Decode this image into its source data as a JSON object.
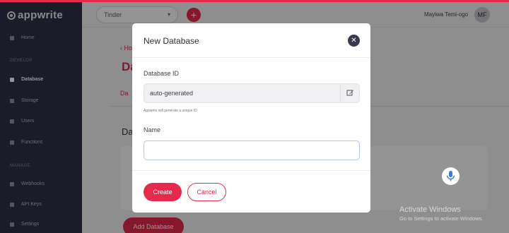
{
  "app": {
    "logo_text": "appwrite"
  },
  "sidebar": {
    "items": [
      {
        "label": "Home",
        "icon": "home-icon"
      },
      {
        "label": "Database",
        "icon": "database-icon",
        "active": true
      },
      {
        "label": "Storage",
        "icon": "storage-icon"
      },
      {
        "label": "Users",
        "icon": "users-icon"
      },
      {
        "label": "Functions",
        "icon": "functions-icon"
      },
      {
        "label": "Webhooks",
        "icon": "webhooks-icon"
      },
      {
        "label": "API Keys",
        "icon": "api-keys-icon"
      },
      {
        "label": "Settings",
        "icon": "settings-icon"
      }
    ],
    "sections": [
      "DEVELOP",
      "MANAGE"
    ]
  },
  "topbar": {
    "project": "Tinder",
    "add_label": "+",
    "user_name": "Mayiwa Temi-ogo",
    "avatar_initials": "MF"
  },
  "main": {
    "back_label": "‹ Ho",
    "title": "Da",
    "tab_label": "Da",
    "section_title": "Da",
    "add_button_label": "Add Database"
  },
  "modal": {
    "title": "New Database",
    "close_label": "✕",
    "id_label": "Database ID",
    "id_value": "auto-generated",
    "id_hint": "Appwrite will generate a unique ID",
    "name_label": "Name",
    "name_value": "",
    "create_label": "Create",
    "cancel_label": "Cancel"
  },
  "watermark": {
    "line1": "Activate Windows",
    "line2": "Go to Settings to activate Windows."
  },
  "colors": {
    "accent": "#e52a4e",
    "sidebar_bg": "#2e3347",
    "overlay": "rgba(0,0,0,0.42)"
  }
}
